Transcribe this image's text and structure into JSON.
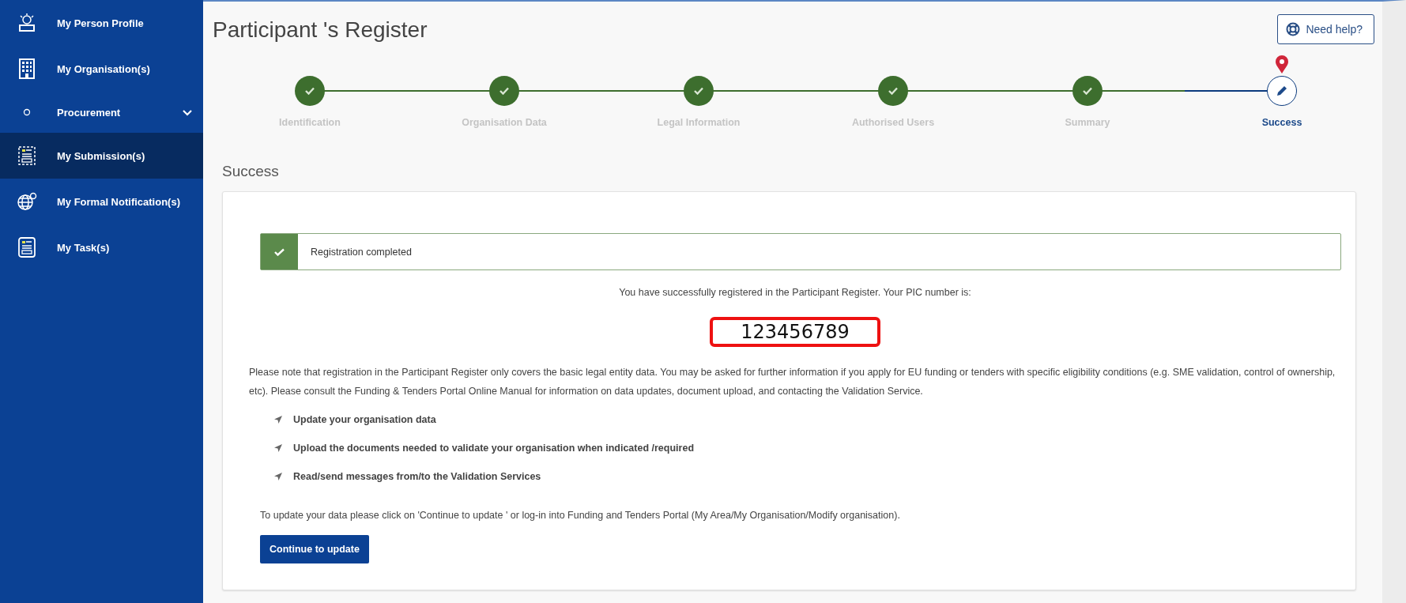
{
  "sidebar": {
    "items": [
      {
        "label": "My Person Profile",
        "kind": "link",
        "selected": false
      },
      {
        "label": "My Organisation(s)",
        "kind": "link",
        "selected": false
      },
      {
        "label": "Procurement",
        "kind": "group",
        "selected": false,
        "expanded": false
      },
      {
        "label": "My Submission(s)",
        "kind": "link",
        "selected": true
      },
      {
        "label": "My Formal Notification(s)",
        "kind": "link",
        "selected": false
      },
      {
        "label": "My Task(s)",
        "kind": "link",
        "selected": false
      }
    ]
  },
  "page": {
    "title": "Participant 's Register",
    "help_button": "Need help?"
  },
  "stepper": {
    "steps": [
      {
        "label": "Identification",
        "completed": true,
        "selected": false
      },
      {
        "label": "Organisation Data",
        "completed": true,
        "selected": false
      },
      {
        "label": "Legal Information",
        "completed": true,
        "selected": false
      },
      {
        "label": "Authorised Users",
        "completed": true,
        "selected": false
      },
      {
        "label": "Summary",
        "completed": true,
        "selected": false
      },
      {
        "label": "Success",
        "completed": false,
        "selected": true
      }
    ]
  },
  "section_title": "Success",
  "card": {
    "alert": "Registration completed",
    "intro": "You have successfully registered in the Participant Register. Your PIC number is:",
    "pic_number": "123456789",
    "note": "Please note that registration in the Participant Register only covers the basic legal entity data. You may be asked for further information if you apply for EU funding or tenders with specific eligibility conditions (e.g. SME validation, control of ownership, etc). Please consult the Funding & Tenders Portal Online Manual for information on data updates, document upload, and contacting the Validation Service.",
    "bullets": [
      "Update your organisation data",
      "Upload the documents needed to validate your organisation when indicated /required",
      "Read/send messages from/to the Validation Services"
    ],
    "update_text": "To update your data please click on 'Continue to update ' or log-in into Funding and Tenders Portal (My Area/My Organisation/Modify organisation).",
    "button": "Continue to update"
  }
}
